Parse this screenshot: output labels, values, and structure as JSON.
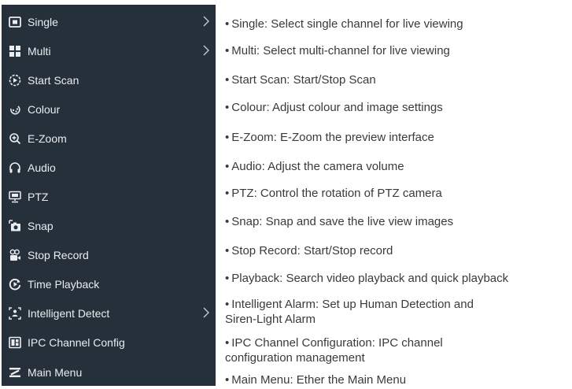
{
  "menu": {
    "items": [
      {
        "label": "Single",
        "icon": "single-view-icon",
        "submenu": true
      },
      {
        "label": "Multi",
        "icon": "multi-view-icon",
        "submenu": true
      },
      {
        "label": "Start Scan",
        "icon": "scan-icon",
        "submenu": false
      },
      {
        "label": "Colour",
        "icon": "colour-icon",
        "submenu": false
      },
      {
        "label": "E-Zoom",
        "icon": "zoom-icon",
        "submenu": false
      },
      {
        "label": "Audio",
        "icon": "headphones-icon",
        "submenu": false
      },
      {
        "label": "PTZ",
        "icon": "ptz-icon",
        "submenu": false
      },
      {
        "label": "Snap",
        "icon": "snap-icon",
        "submenu": false
      },
      {
        "label": "Stop Record",
        "icon": "record-icon",
        "submenu": false
      },
      {
        "label": "Time Playback",
        "icon": "playback-icon",
        "submenu": false
      },
      {
        "label": "Intelligent Detect",
        "icon": "intelligent-detect-icon",
        "submenu": true
      },
      {
        "label": "IPC Channel Config",
        "icon": "ipc-config-icon",
        "submenu": false
      },
      {
        "label": "Main Menu",
        "icon": "main-menu-icon",
        "submenu": false
      }
    ]
  },
  "descriptions": [
    "Single: Select single channel for live viewing",
    "Multi: Select multi-channel for live viewing",
    "Start Scan: Start/Stop Scan",
    "Colour: Adjust colour and image settings",
    "E-Zoom: E-Zoom the preview interface",
    "Audio: Adjust the camera volume",
    "PTZ: Control the rotation of PTZ camera",
    "Snap: Snap and save the live view images",
    "Stop Record: Start/Stop record",
    "Playback: Search video playback and quick playback",
    "Intelligent Alarm: Set up Human Detection and",
    "Siren-Light Alarm",
    "IPC Channel Configuration: IPC channel",
    "configuration management",
    "Main Menu: Ether the Main Menu"
  ],
  "colors": {
    "menu_bg": "#26303b",
    "menu_text": "#e9edf1",
    "desc_text": "#3a3a3a"
  }
}
